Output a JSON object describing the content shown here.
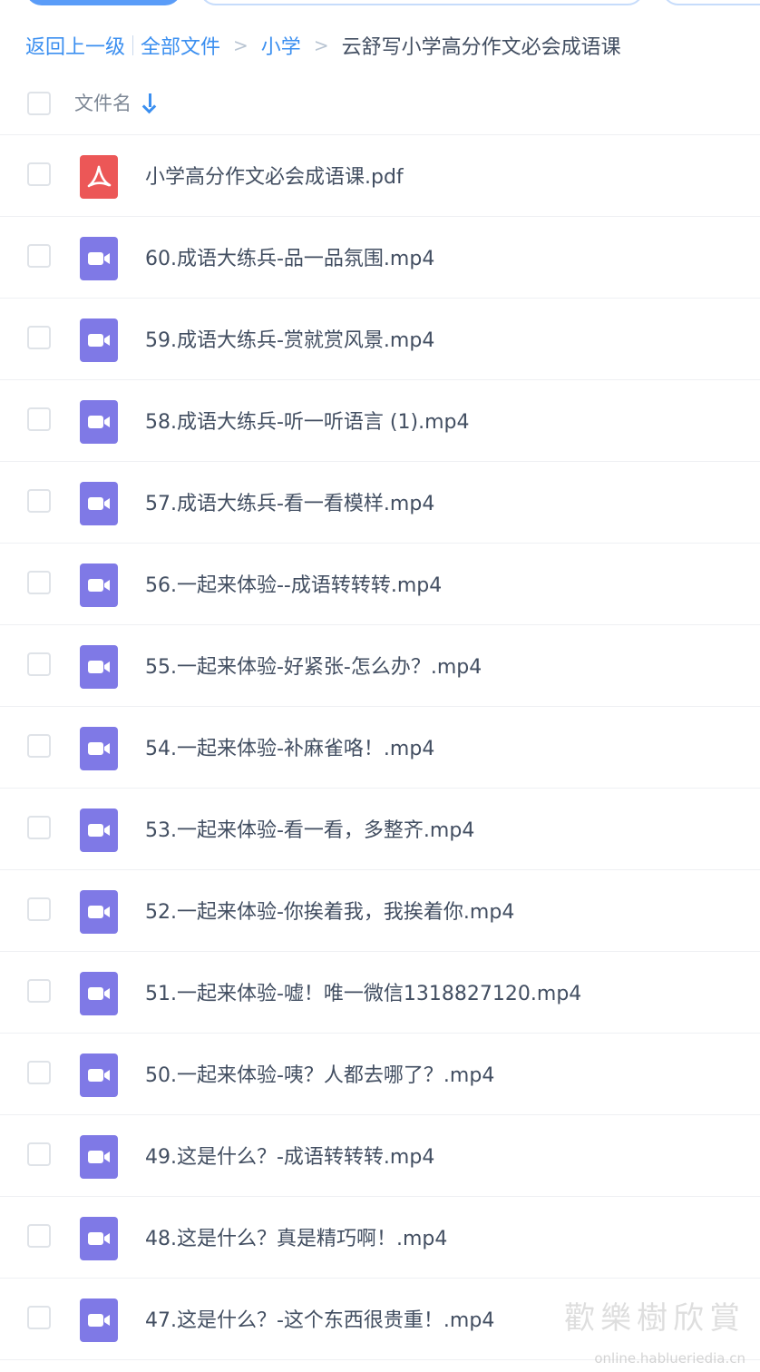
{
  "breadcrumb": {
    "back": "返回上一级",
    "all_files": "全部文件",
    "level1": "小学",
    "current": "云舒写小学高分作文必会成语课",
    "sep": ">"
  },
  "header": {
    "column_label": "文件名"
  },
  "files": [
    {
      "name": "小学高分作文必会成语课.pdf",
      "type": "pdf"
    },
    {
      "name": "60.成语大练兵-品一品氛围.mp4",
      "type": "video"
    },
    {
      "name": "59.成语大练兵-赏就赏风景.mp4",
      "type": "video"
    },
    {
      "name": "58.成语大练兵-听一听语言 (1).mp4",
      "type": "video"
    },
    {
      "name": "57.成语大练兵-看一看模样.mp4",
      "type": "video"
    },
    {
      "name": "56.一起来体验--成语转转转.mp4",
      "type": "video"
    },
    {
      "name": "55.一起来体验-好紧张-怎么办？.mp4",
      "type": "video"
    },
    {
      "name": "54.一起来体验-补麻雀咯！.mp4",
      "type": "video"
    },
    {
      "name": "53.一起来体验-看一看，多整齐.mp4",
      "type": "video"
    },
    {
      "name": "52.一起来体验-你挨着我，我挨着你.mp4",
      "type": "video"
    },
    {
      "name": "51.一起来体验-嘘！唯一微信1318827120.mp4",
      "type": "video"
    },
    {
      "name": "50.一起来体验-咦？人都去哪了？.mp4",
      "type": "video"
    },
    {
      "name": "49.这是什么？-成语转转转.mp4",
      "type": "video"
    },
    {
      "name": "48.这是什么？真是精巧啊！.mp4",
      "type": "video"
    },
    {
      "name": "47.这是什么？-这个东西很贵重！.mp4",
      "type": "video"
    }
  ],
  "icons": {
    "pdf": "pdf-file-icon",
    "video": "video-file-icon",
    "sort": "arrow-down-icon"
  },
  "colors": {
    "link": "#3b8ff0",
    "pdf": "#ec5757",
    "video": "#7f79e6",
    "text": "#424e61"
  },
  "watermark": {
    "text": "歡樂樹欣賞",
    "url": "online.hablueriedia.cn"
  }
}
